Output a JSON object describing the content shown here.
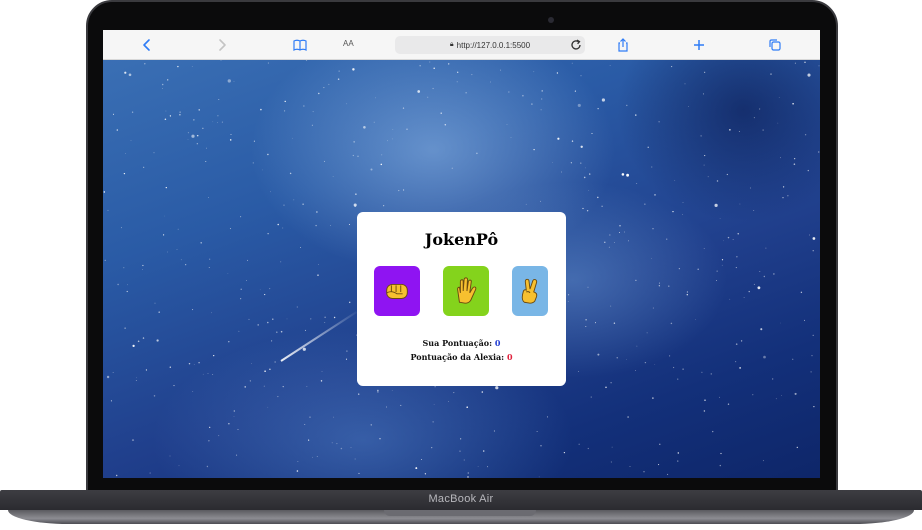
{
  "device": {
    "model_label": "MacBook Air"
  },
  "browser": {
    "url": "http://127.0.0.1:5500",
    "reader_label": "AA",
    "icons": [
      "back-icon",
      "forward-icon",
      "bookmarks-icon",
      "lock-icon",
      "reload-icon",
      "share-icon",
      "new-tab-icon",
      "tabs-icon"
    ]
  },
  "game": {
    "title": "JokenPô",
    "choices": [
      {
        "name": "rock",
        "color": "#8f14f2"
      },
      {
        "name": "paper",
        "color": "#84d31c"
      },
      {
        "name": "scissors",
        "color": "#79b6e6"
      }
    ],
    "your_score_label": "Sua Pontuação:",
    "your_score_value": "0",
    "alexia_score_label": "Pontuação da Alexia:",
    "alexia_score_value": "0"
  }
}
